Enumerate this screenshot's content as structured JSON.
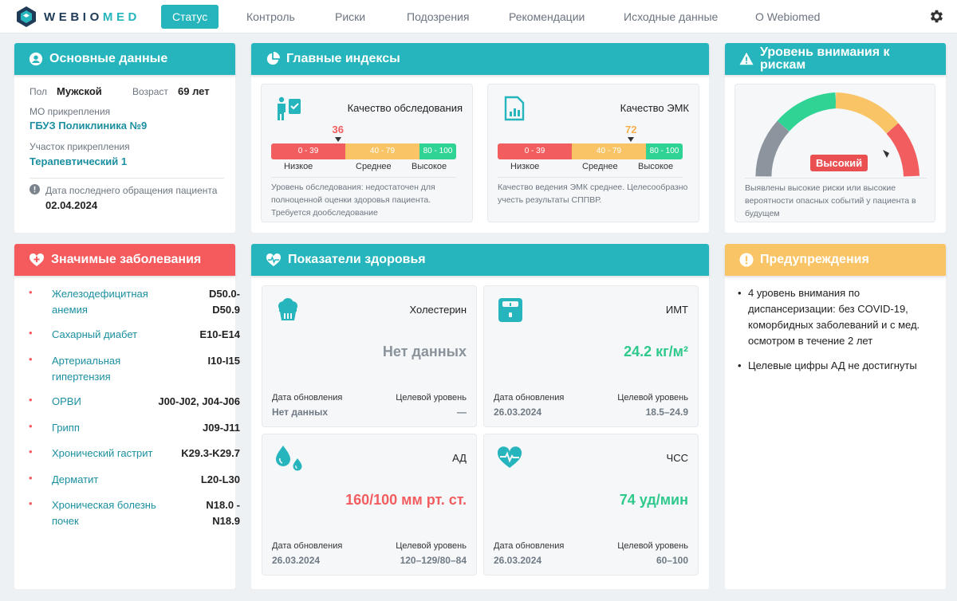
{
  "app": {
    "logo_a": "WEBIO",
    "logo_b": "MED"
  },
  "nav": {
    "items": [
      "Статус",
      "Контроль",
      "Риски",
      "Подозрения",
      "Рекомендации",
      "Исходные данные",
      "О Webiomed"
    ],
    "active": "Статус"
  },
  "basic": {
    "title": "Основные данные",
    "sex_label": "Пол",
    "sex_value": "Мужской",
    "age_label": "Возраст",
    "age_value": "69 лет",
    "mo_label": "МО прикрепления",
    "mo_value": "ГБУЗ Поликлиника №9",
    "area_label": "Участок прикрепления",
    "area_value": "Терапевтический 1",
    "last_visit_label": "Дата последнего обращения пациента",
    "last_visit_value": "02.04.2024"
  },
  "indices": {
    "title": "Главные индексы",
    "exam": {
      "title": "Качество обследования",
      "value": "36",
      "value_num": 36,
      "segments": [
        "0 - 39",
        "40 - 79",
        "80 - 100"
      ],
      "levels": [
        "Низкое",
        "Среднее",
        "Высокое"
      ],
      "note": "Уровень обследования: недостаточен для полноценной оценки здоровья пациента. Требуется дообследование"
    },
    "emk": {
      "title": "Качество ЭМК",
      "value": "72",
      "value_num": 72,
      "segments": [
        "0 - 39",
        "40 - 79",
        "80 - 100"
      ],
      "levels": [
        "Низкое",
        "Среднее",
        "Высокое"
      ],
      "note": "Качество ведения ЭМК среднее. Целесообразно учесть результаты СППВР."
    }
  },
  "attention": {
    "title": "Уровень внимания к рискам",
    "badge": "Высокий",
    "note": "Выявлены высокие риски или высокие вероятности опасных событий у пациента в будущем"
  },
  "diseases": {
    "title": "Значимые заболевания",
    "items": [
      {
        "name": "Железодефицитная анемия",
        "code": "D50.0-D50.9"
      },
      {
        "name": "Сахарный диабет",
        "code": "E10-E14"
      },
      {
        "name": "Артериальная гипертензия",
        "code": "I10-I15"
      },
      {
        "name": "ОРВИ",
        "code": "J00-J02, J04-J06"
      },
      {
        "name": "Грипп",
        "code": "J09-J11"
      },
      {
        "name": "Хронический гастрит",
        "code": "K29.3-K29.7"
      },
      {
        "name": "Дерматит",
        "code": "L20-L30"
      },
      {
        "name": "Хроническая болезнь почек",
        "code": "N18.0 - N18.9"
      }
    ]
  },
  "health": {
    "title": "Показатели здоровья",
    "cards": [
      {
        "title": "Холестерин",
        "value": "Нет данных",
        "color": "#8a939c",
        "date_label": "Дата обновления",
        "date": "Нет данных",
        "target_label": "Целевой уровень",
        "target": "—"
      },
      {
        "title": "ИМТ",
        "value": "24.2 кг/м²",
        "color": "#2fc98c",
        "date_label": "Дата обновления",
        "date": "26.03.2024",
        "target_label": "Целевой уровень",
        "target": "18.5–24.9"
      },
      {
        "title": "АД",
        "value": "160/100 мм рт. ст.",
        "color": "#f25d5f",
        "date_label": "Дата обновления",
        "date": "26.03.2024",
        "target_label": "Целевой уровень",
        "target": "120–129/80–84"
      },
      {
        "title": "ЧСС",
        "value": "74 уд/мин",
        "color": "#2fc98c",
        "date_label": "Дата обновления",
        "date": "26.03.2024",
        "target_label": "Целевой уровень",
        "target": "60–100"
      }
    ]
  },
  "warnings": {
    "title": "Предупреждения",
    "items": [
      "4 уровень внимания по диспансеризации: без COVID-19, коморбидных заболеваний и с мед. осмотром в течение 2 лет",
      "Целевые цифры АД не достигнуты"
    ]
  },
  "colors": {
    "teal": "#26b5bd",
    "red": "#f55a5d",
    "orange": "#f8c466",
    "green": "#2fd494"
  }
}
